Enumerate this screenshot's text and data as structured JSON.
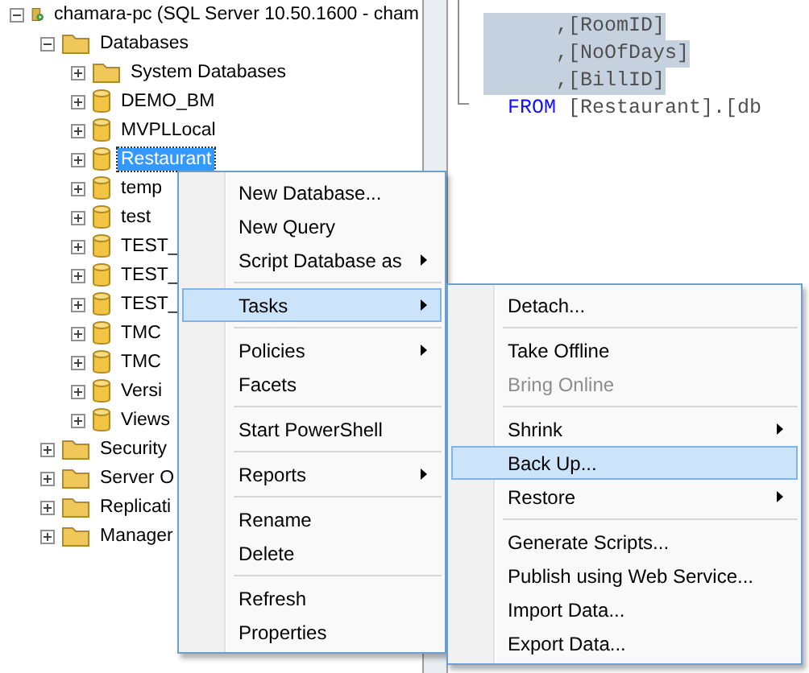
{
  "tree": [
    {
      "label": "chamara-pc (SQL Server 10.50.1600 - cham",
      "kind": "server",
      "expanded": true,
      "selected": false,
      "children": [
        {
          "label": "Databases",
          "kind": "folder",
          "expanded": true,
          "selected": false,
          "children": [
            {
              "label": "System Databases",
              "kind": "folder",
              "expanded": false,
              "selected": false
            },
            {
              "label": "DEMO_BM",
              "kind": "database",
              "expanded": false,
              "selected": false
            },
            {
              "label": "MVPLLocal",
              "kind": "database",
              "expanded": false,
              "selected": false
            },
            {
              "label": "Restaurant",
              "kind": "database",
              "expanded": false,
              "selected": true
            },
            {
              "label": "temp",
              "kind": "database",
              "expanded": false,
              "selected": false
            },
            {
              "label": "test",
              "kind": "database",
              "expanded": false,
              "selected": false
            },
            {
              "label": "TEST_",
              "kind": "database",
              "expanded": false,
              "selected": false
            },
            {
              "label": "TEST_",
              "kind": "database",
              "expanded": false,
              "selected": false
            },
            {
              "label": "TEST_",
              "kind": "database",
              "expanded": false,
              "selected": false
            },
            {
              "label": "TMC",
              "kind": "database",
              "expanded": false,
              "selected": false
            },
            {
              "label": "TMC",
              "kind": "database",
              "expanded": false,
              "selected": false
            },
            {
              "label": "Versi",
              "kind": "database",
              "expanded": false,
              "selected": false
            },
            {
              "label": "Views",
              "kind": "database",
              "expanded": false,
              "selected": false
            }
          ]
        },
        {
          "label": "Security",
          "kind": "folder",
          "expanded": false,
          "selected": false
        },
        {
          "label": "Server O",
          "kind": "folder",
          "expanded": false,
          "selected": false
        },
        {
          "label": "Replicati",
          "kind": "folder",
          "expanded": false,
          "selected": false
        },
        {
          "label": "Manager",
          "kind": "folder",
          "expanded": false,
          "selected": false
        }
      ]
    }
  ],
  "editor": {
    "lines": [
      {
        "highlighted": true,
        "tokens": [
          {
            "kind": "plain",
            "text": "      ,[RoomID]"
          }
        ]
      },
      {
        "highlighted": true,
        "tokens": [
          {
            "kind": "plain",
            "text": "      ,[NoOfDays]"
          }
        ]
      },
      {
        "highlighted": true,
        "tokens": [
          {
            "kind": "plain",
            "text": "      ,[BillID]"
          }
        ]
      },
      {
        "highlighted": false,
        "tokens": [
          {
            "kind": "keyword",
            "text": "  FROM "
          },
          {
            "kind": "plain",
            "text": "[Restaurant].[db"
          }
        ]
      }
    ]
  },
  "context_menu": {
    "items": [
      {
        "kind": "item",
        "label": "New Database...",
        "submenu": false,
        "selected": false,
        "disabled": false
      },
      {
        "kind": "item",
        "label": "New Query",
        "submenu": false,
        "selected": false,
        "disabled": false
      },
      {
        "kind": "item",
        "label": "Script Database as",
        "submenu": true,
        "selected": false,
        "disabled": false
      },
      {
        "kind": "separator"
      },
      {
        "kind": "item",
        "label": "Tasks",
        "submenu": true,
        "selected": true,
        "disabled": false
      },
      {
        "kind": "separator"
      },
      {
        "kind": "item",
        "label": "Policies",
        "submenu": true,
        "selected": false,
        "disabled": false
      },
      {
        "kind": "item",
        "label": "Facets",
        "submenu": false,
        "selected": false,
        "disabled": false
      },
      {
        "kind": "separator"
      },
      {
        "kind": "item",
        "label": "Start PowerShell",
        "submenu": false,
        "selected": false,
        "disabled": false
      },
      {
        "kind": "separator"
      },
      {
        "kind": "item",
        "label": "Reports",
        "submenu": true,
        "selected": false,
        "disabled": false
      },
      {
        "kind": "separator"
      },
      {
        "kind": "item",
        "label": "Rename",
        "submenu": false,
        "selected": false,
        "disabled": false
      },
      {
        "kind": "item",
        "label": "Delete",
        "submenu": false,
        "selected": false,
        "disabled": false
      },
      {
        "kind": "separator"
      },
      {
        "kind": "item",
        "label": "Refresh",
        "submenu": false,
        "selected": false,
        "disabled": false
      },
      {
        "kind": "item",
        "label": "Properties",
        "submenu": false,
        "selected": false,
        "disabled": false
      }
    ]
  },
  "tasks_menu": {
    "items": [
      {
        "kind": "item",
        "label": "Detach...",
        "submenu": false,
        "selected": false,
        "disabled": false
      },
      {
        "kind": "separator"
      },
      {
        "kind": "item",
        "label": "Take Offline",
        "submenu": false,
        "selected": false,
        "disabled": false
      },
      {
        "kind": "item",
        "label": "Bring Online",
        "submenu": false,
        "selected": false,
        "disabled": true
      },
      {
        "kind": "separator"
      },
      {
        "kind": "item",
        "label": "Shrink",
        "submenu": true,
        "selected": false,
        "disabled": false
      },
      {
        "kind": "item",
        "label": "Back Up...",
        "submenu": false,
        "selected": true,
        "disabled": false
      },
      {
        "kind": "item",
        "label": "Restore",
        "submenu": true,
        "selected": false,
        "disabled": false
      },
      {
        "kind": "separator"
      },
      {
        "kind": "item",
        "label": "Generate Scripts...",
        "submenu": false,
        "selected": false,
        "disabled": false
      },
      {
        "kind": "item",
        "label": "Publish using Web Service...",
        "submenu": false,
        "selected": false,
        "disabled": false
      },
      {
        "kind": "item",
        "label": "Import Data...",
        "submenu": false,
        "selected": false,
        "disabled": false
      },
      {
        "kind": "item",
        "label": "Export Data...",
        "submenu": false,
        "selected": false,
        "disabled": false
      }
    ]
  }
}
